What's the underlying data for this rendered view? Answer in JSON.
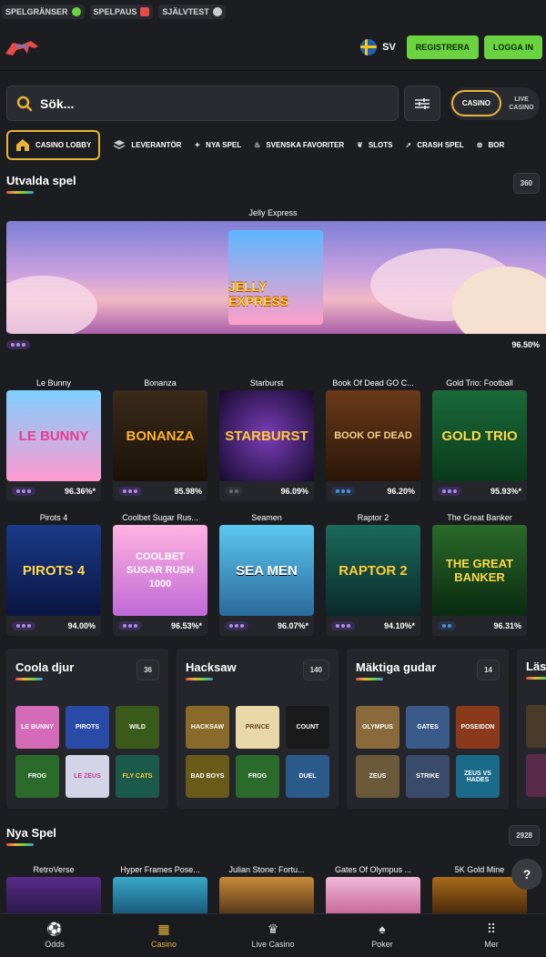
{
  "topbar": {
    "items": [
      "SPELGRÄNSER",
      "SPELPAUS",
      "SJÄLVTEST"
    ]
  },
  "header": {
    "lang": "SV",
    "register_label": "REGISTRERA",
    "login_label": "LOGGA IN"
  },
  "search": {
    "placeholder": "Sök..."
  },
  "switch": {
    "casino": "CASINO",
    "live_casino_1": "LIVE",
    "live_casino_2": "CASINO"
  },
  "categories": [
    "CASINO LOBBY",
    "LEVERANTÖR",
    "NYA SPEL",
    "SVENSKA FAVORITER",
    "SLOTS",
    "CRASH SPEL",
    "BOR"
  ],
  "featured": {
    "title": "Utvalda spel",
    "count": "360",
    "hero_name": "Jelly Express",
    "hero_art": "JELLY EXPRESS",
    "hero_rtp": "96.50%"
  },
  "row1": [
    {
      "name": "Le Bunny",
      "art": "LE BUNNY",
      "rtp": "96.36%*",
      "dots": "purple"
    },
    {
      "name": "Bonanza",
      "art": "BONANZA",
      "rtp": "95.98%",
      "dots": "purple"
    },
    {
      "name": "Starburst",
      "art": "STARBURST",
      "rtp": "96.09%",
      "dots": "gray"
    },
    {
      "name": "Book Of Dead GO C...",
      "art": "BOOK OF DEAD",
      "rtp": "96.20%",
      "dots": "blue"
    },
    {
      "name": "Gold Trio: Football",
      "art": "GOLD TRIO",
      "rtp": "95.93%*",
      "dots": "purple"
    }
  ],
  "row2": [
    {
      "name": "Pirots 4",
      "art": "PIROTS 4",
      "rtp": "94.00%",
      "dots": "purple"
    },
    {
      "name": "Coolbet Sugar Rus...",
      "art": "COOLBET SUGAR RUSH 1000",
      "rtp": "96.53%*",
      "dots": "purple"
    },
    {
      "name": "Seamen",
      "art": "SEA MEN",
      "rtp": "96.07%*",
      "dots": "purple"
    },
    {
      "name": "Raptor 2",
      "art": "RAPTOR 2",
      "rtp": "94.10%*",
      "dots": "purple"
    },
    {
      "name": "The Great Banker",
      "art": "THE GREAT BANKER",
      "rtp": "96.31%",
      "dots": "blue"
    }
  ],
  "providers": [
    {
      "title": "Coola djur",
      "count": "36",
      "tiles": [
        "LE BUNNY",
        "PIROTS",
        "WILD",
        "FROG",
        "LE ZEUS",
        "FLY CATS"
      ]
    },
    {
      "title": "Hacksaw",
      "count": "140",
      "tiles": [
        "HACKSAW",
        "PRINCE",
        "COUNT",
        "BAD BOYS",
        "FROG",
        "DUEL"
      ]
    },
    {
      "title": "Mäktiga gudar",
      "count": "14",
      "tiles": [
        "OLYMPUS",
        "GATES",
        "POSEIDON",
        "ZEUS",
        "STRIKE",
        "ZEUS VS HADES"
      ]
    },
    {
      "title": "Läsig",
      "count": "",
      "tiles": [
        "",
        "",
        "",
        "",
        "",
        ""
      ]
    }
  ],
  "new_games": {
    "title": "Nya Spel",
    "count": "2928",
    "games": [
      "RetroVerse",
      "Hyper Frames Pose...",
      "Julian Stone: Fortu...",
      "Gates Of Olympus ...",
      "5K Gold Mine"
    ]
  },
  "bottomnav": [
    "Odds",
    "Casino",
    "Live Casino",
    "Poker",
    "Mer"
  ],
  "colors": {
    "accent": "#e8b53a",
    "green": "#6bd33f",
    "bg": "#1c1d21"
  }
}
